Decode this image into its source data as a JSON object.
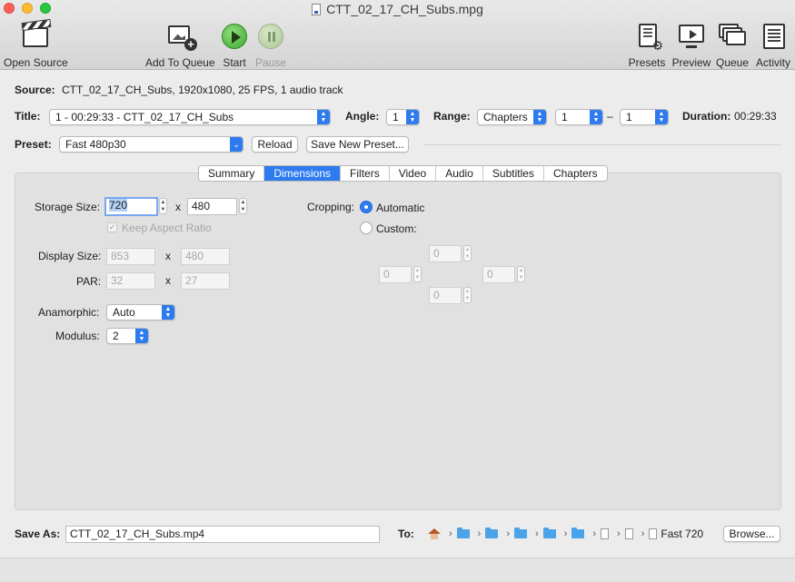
{
  "window": {
    "title": "CTT_02_17_CH_Subs.mpg"
  },
  "toolbar": {
    "open_source": "Open Source",
    "add_to_queue": "Add To Queue",
    "start": "Start",
    "pause": "Pause",
    "presets": "Presets",
    "preview": "Preview",
    "queue": "Queue",
    "activity": "Activity"
  },
  "source": {
    "label": "Source:",
    "value": "CTT_02_17_CH_Subs, 1920x1080, 25 FPS, 1 audio track"
  },
  "title_row": {
    "title_label": "Title:",
    "title_value": "1 - 00:29:33 - CTT_02_17_CH_Subs",
    "angle_label": "Angle:",
    "angle_value": "1",
    "range_label": "Range:",
    "range_type": "Chapters",
    "range_start": "1",
    "range_dash": "–",
    "range_end": "1",
    "duration_label": "Duration:",
    "duration_value": "00:29:33"
  },
  "preset_row": {
    "label": "Preset:",
    "value": "Fast 480p30",
    "reload": "Reload",
    "save_new": "Save New Preset..."
  },
  "tabs": [
    "Summary",
    "Dimensions",
    "Filters",
    "Video",
    "Audio",
    "Subtitles",
    "Chapters"
  ],
  "active_tab": "Dimensions",
  "dimensions": {
    "storage_label": "Storage Size:",
    "storage_w": "720",
    "storage_x": "x",
    "storage_h": "480",
    "keep_aspect": "Keep Aspect Ratio",
    "keep_aspect_checked": true,
    "display_label": "Display Size:",
    "display_w": "853",
    "display_x": "x",
    "display_h": "480",
    "par_label": "PAR:",
    "par_w": "32",
    "par_x": "x",
    "par_h": "27",
    "anamorphic_label": "Anamorphic:",
    "anamorphic_value": "Auto",
    "modulus_label": "Modulus:",
    "modulus_value": "2",
    "cropping_label": "Cropping:",
    "crop_automatic": "Automatic",
    "crop_custom": "Custom:",
    "crop_mode": "Automatic",
    "crop_top": "0",
    "crop_left": "0",
    "crop_right": "0",
    "crop_bottom": "0"
  },
  "save": {
    "label": "Save As:",
    "filename": "CTT_02_17_CH_Subs.mp4",
    "to_label": "To:",
    "path_tail": "Fast 720",
    "browse": "Browse..."
  },
  "colors": {
    "accent": "#2e7bf0",
    "start_green": "#3fa52e"
  }
}
